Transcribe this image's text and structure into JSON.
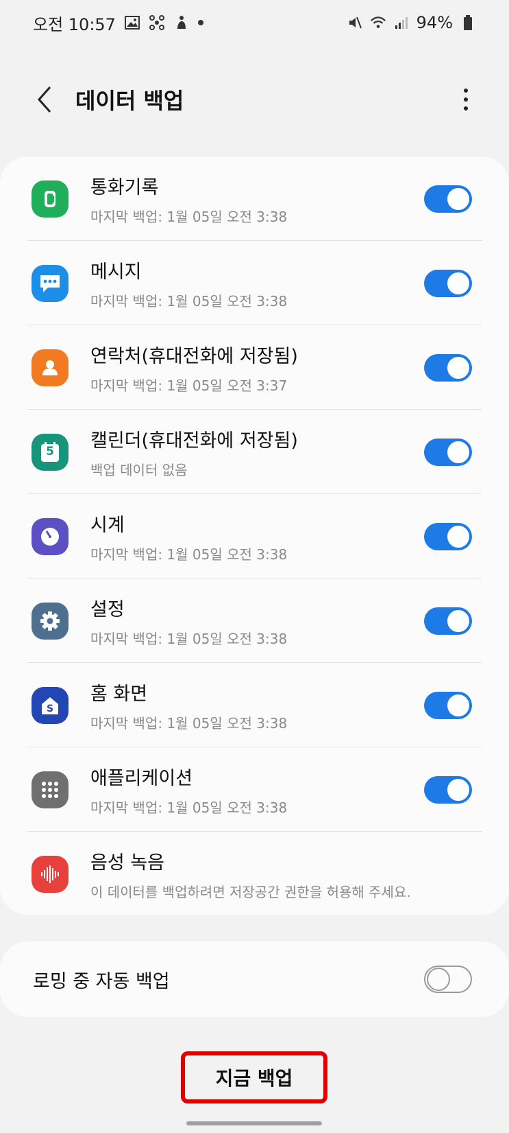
{
  "status_bar": {
    "time": "오전 10:57",
    "battery": "94%"
  },
  "header": {
    "title": "데이터 백업"
  },
  "items": [
    {
      "label": "통화기록",
      "sub": "마지막 백업: 1월 05일 오전 3:38",
      "icon": "phone-icon",
      "color": "#1fae5a",
      "toggle": true
    },
    {
      "label": "메시지",
      "sub": "마지막 백업: 1월 05일 오전 3:38",
      "icon": "message-icon",
      "color": "#1d8ee8",
      "toggle": true
    },
    {
      "label": "연락처(휴대전화에 저장됨)",
      "sub": "마지막 백업: 1월 05일 오전 3:37",
      "icon": "contact-icon",
      "color": "#f27a23",
      "toggle": true
    },
    {
      "label": "캘린더(휴대전화에 저장됨)",
      "sub": "백업 데이터 없음",
      "icon": "calendar-icon",
      "color": "#17957a",
      "toggle": true
    },
    {
      "label": "시계",
      "sub": "마지막 백업: 1월 05일 오전 3:38",
      "icon": "clock-icon",
      "color": "#5d4fc4",
      "toggle": true
    },
    {
      "label": "설정",
      "sub": "마지막 백업: 1월 05일 오전 3:38",
      "icon": "gear-icon",
      "color": "#4e6f8e",
      "toggle": true
    },
    {
      "label": "홈 화면",
      "sub": "마지막 백업: 1월 05일 오전 3:38",
      "icon": "home-screen-icon",
      "color": "#2246b3",
      "toggle": true
    },
    {
      "label": "애플리케이션",
      "sub": "마지막 백업: 1월 05일 오전 3:38",
      "icon": "apps-grid-icon",
      "color": "#6f6f6f",
      "toggle": true
    },
    {
      "label": "음성 녹음",
      "sub": "이 데이터를 백업하려면 저장공간 권한을 허용해 주세요.",
      "icon": "voice-recorder-icon",
      "color": "#e8403d",
      "toggle": null
    }
  ],
  "roaming": {
    "label": "로밍 중 자동 백업",
    "toggle": false
  },
  "backup_now_label": "지금 백업",
  "calendar_day": "5"
}
